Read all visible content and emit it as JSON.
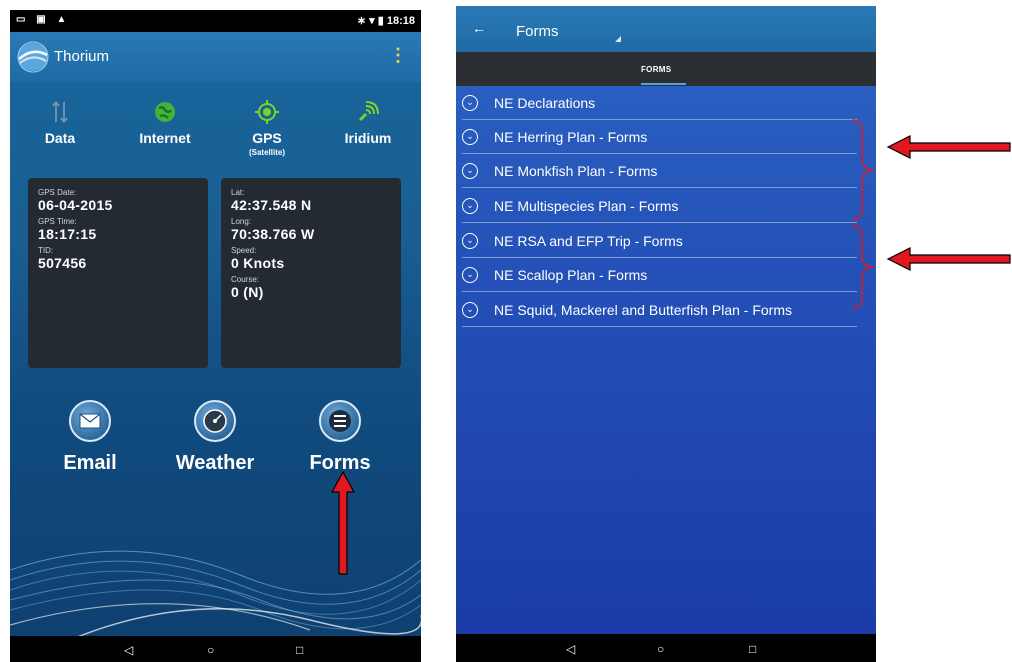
{
  "left_screen": {
    "status_bar": {
      "time": "18:18"
    },
    "app_bar": {
      "title": "Thorium"
    },
    "status_items": [
      {
        "label": "Data",
        "sub": ""
      },
      {
        "label": "Internet",
        "sub": ""
      },
      {
        "label": "GPS",
        "sub": "(Satellite)"
      },
      {
        "label": "Iridium",
        "sub": ""
      }
    ],
    "gps_card": {
      "date_label": "GPS Date:",
      "date_value": "06-04-2015",
      "time_label": "GPS Time:",
      "time_value": "18:17:15",
      "tid_label": "TID:",
      "tid_value": "507456"
    },
    "position_card": {
      "lat_label": "Lat:",
      "lat_value": "42:37.548 N",
      "long_label": "Long:",
      "long_value": "70:38.766 W",
      "speed_label": "Speed:",
      "speed_value": "0 Knots",
      "course_label": "Course:",
      "course_value": "0 (N)"
    },
    "actions": [
      {
        "label": "Email",
        "icon": "envelope-icon"
      },
      {
        "label": "Weather",
        "icon": "gauge-icon"
      },
      {
        "label": "Forms",
        "icon": "list-icon"
      }
    ]
  },
  "right_screen": {
    "app_bar": {
      "title": "Forms"
    },
    "tab": {
      "label": "FORMS"
    },
    "forms": [
      "NE Declarations",
      "NE Herring Plan - Forms",
      "NE Monkfish Plan - Forms",
      "NE Multispecies Plan - Forms",
      "NE RSA and EFP Trip - Forms",
      "NE Scallop Plan - Forms",
      "NE Squid, Mackerel and Butterfish Plan - Forms"
    ]
  },
  "colors": {
    "annotation_red": "#e0181f",
    "accent_blue": "#4fa3e0",
    "card_dark": "#232a32"
  }
}
